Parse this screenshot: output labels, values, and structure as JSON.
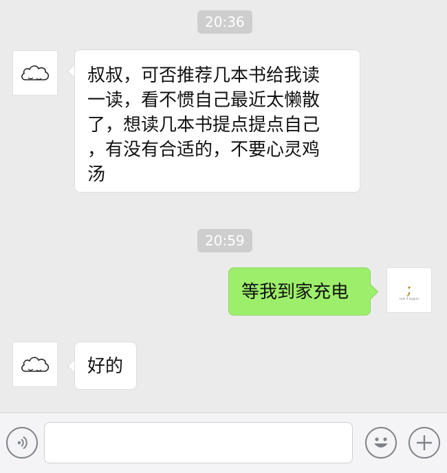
{
  "messages": [
    {
      "type": "time",
      "text": "20:36"
    },
    {
      "type": "in",
      "avatar": "cloud-icon",
      "lines": [
        "叔叔，可否推荐几本书给我读",
        "一读，看不惯自己最近太懒散",
        "了，想读几本书提点提点自己",
        "，有没有合适的，不要心灵鸡",
        "汤"
      ]
    },
    {
      "type": "time",
      "text": "20:59"
    },
    {
      "type": "out",
      "text": "等我到家充电",
      "avatar": {
        "symbol": ";",
        "caption": "now it begins"
      }
    },
    {
      "type": "in",
      "avatar": "cloud-icon",
      "text": "好的"
    }
  ],
  "input_bar": {
    "voice_icon": "voice-icon",
    "text_value": "",
    "emoji_icon": "emoji-icon",
    "add_icon": "plus-icon"
  },
  "colors": {
    "background": "#ebebeb",
    "outgoing_bubble": "#9def6b",
    "incoming_bubble": "#ffffff",
    "timestamp_bg": "#cecece"
  }
}
